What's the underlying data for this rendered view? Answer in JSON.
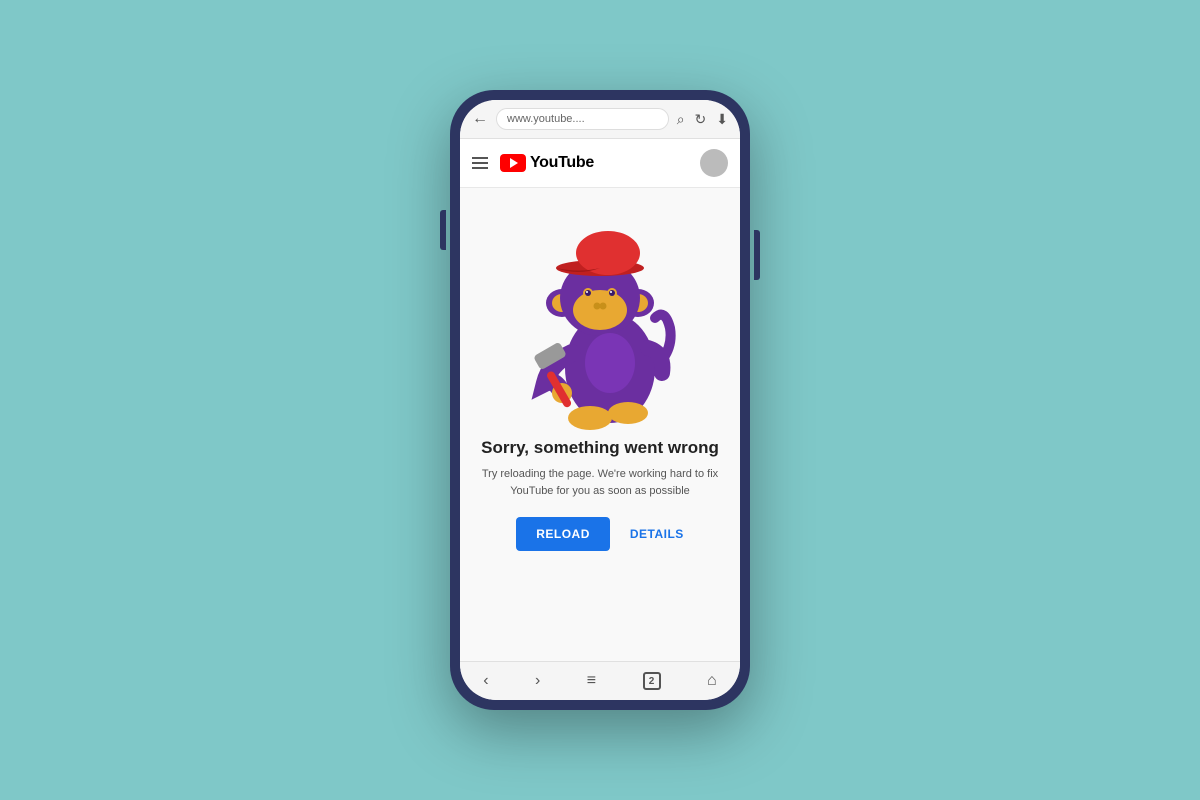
{
  "background": {
    "color": "#7fc8c8"
  },
  "phone": {
    "outer_color": "#2d3561",
    "inner_color": "#ffffff"
  },
  "browser": {
    "url_text": "www.youtube....",
    "back_icon": "←",
    "search_icon": "⌕",
    "refresh_icon": "↻",
    "download_icon": "⬇"
  },
  "youtube_header": {
    "menu_icon": "hamburger",
    "logo_text": "YouTube",
    "avatar_color": "#bbbbbb"
  },
  "error_page": {
    "title": "Sorry, something went wrong",
    "subtitle": "Try reloading the page. We're working hard to fix YouTube\nfor you as soon as possible",
    "reload_button": "RELOAD",
    "details_button": "DETAILS"
  },
  "bottom_nav": {
    "back": "‹",
    "forward": "›",
    "menu": "≡",
    "tabs": "2",
    "home": "⌂"
  },
  "monkey": {
    "body_color": "#6b2fa0",
    "face_color": "#e8a832",
    "hat_color": "#e03030",
    "feet_color": "#e8a832",
    "hammer_handle": "#e03030",
    "hammer_head": "#999999"
  }
}
